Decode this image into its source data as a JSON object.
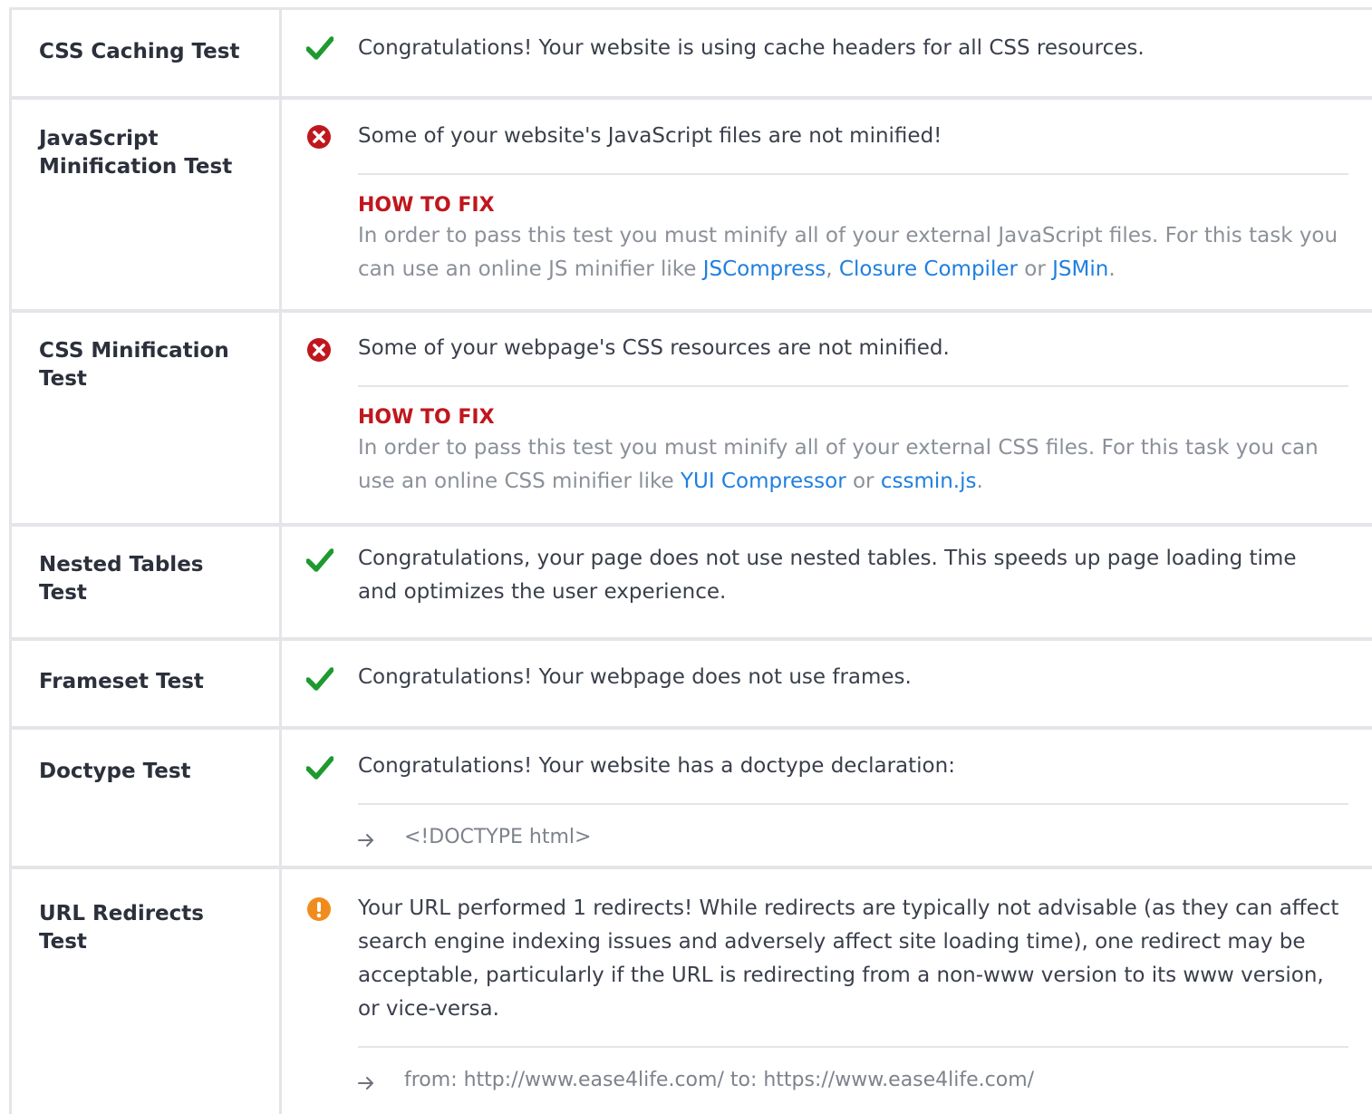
{
  "colors": {
    "pass": "#1e9a2f",
    "fail": "#c0161d",
    "warning": "#f08c1e",
    "link": "#1f7fe0",
    "divider": "#e3e5e8"
  },
  "tests": [
    {
      "name": "CSS Caching Test",
      "status_icon": "check-icon",
      "message": "Congratulations! Your website is using cache headers for all CSS resources."
    },
    {
      "name": "JavaScript Minification Test",
      "status_icon": "error-circle-icon",
      "message": "Some of your website's JavaScript files are not minified!",
      "fix_title": "HOW TO FIX",
      "fix_text_1": "In order to pass this test you must minify all of your external JavaScript files. For this task you can use an online JS minifier like ",
      "link_1": "JSCompress",
      "sep_1": ", ",
      "link_2": "Closure Compiler",
      "sep_2": " or ",
      "link_3": "JSMin",
      "fix_text_end": "."
    },
    {
      "name": "CSS Minification Test",
      "status_icon": "error-circle-icon",
      "message": "Some of your webpage's CSS resources are not minified.",
      "fix_title": "HOW TO FIX",
      "fix_text_1": "In order to pass this test you must minify all of your external CSS files. For this task you can use an online CSS minifier like ",
      "link_1": "YUI Compressor",
      "sep_1": " or ",
      "link_2": "cssmin.js",
      "fix_text_end": "."
    },
    {
      "name": "Nested Tables Test",
      "status_icon": "check-icon",
      "message": "Congratulations, your page does not use nested tables. This speeds up page loading time and optimizes the user experience."
    },
    {
      "name": "Frameset Test",
      "status_icon": "check-icon",
      "message": "Congratulations! Your webpage does not use frames."
    },
    {
      "name": "Doctype Test",
      "status_icon": "check-icon",
      "message": "Congratulations! Your website has a doctype declaration:",
      "detail": "<!DOCTYPE html>"
    },
    {
      "name": "URL Redirects Test",
      "status_icon": "warning-circle-icon",
      "message": "Your URL performed 1 redirects! While redirects are typically not advisable (as they can affect search engine indexing issues and adversely affect site loading time), one redirect may be acceptable, particularly if the URL is redirecting from a non-www version to its www version, or vice-versa.",
      "detail": "from: http://www.ease4life.com/ to: https://www.ease4life.com/"
    }
  ]
}
